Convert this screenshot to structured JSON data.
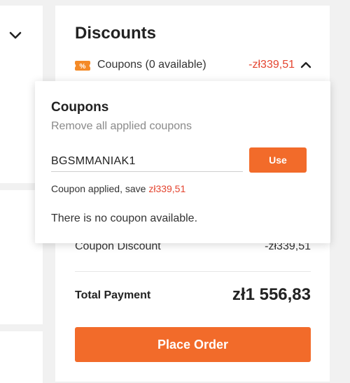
{
  "discounts": {
    "title": "Discounts",
    "coupons_label": "Coupons (0 available)",
    "coupons_amount": "-zł339,51",
    "tag_icon": "coupon-tag-icon",
    "tag_symbol": "%"
  },
  "popup": {
    "title": "Coupons",
    "remove_all": "Remove all applied coupons",
    "code_value": "BGSMMANIAK1",
    "use_label": "Use",
    "applied_prefix": "Coupon applied, save ",
    "applied_amount": "zł339,51",
    "no_coupon": "There is no coupon available."
  },
  "summary": {
    "coupon_discount_label": "Coupon Discount",
    "coupon_discount_value": "-zł339,51",
    "total_label": "Total Payment",
    "total_value": "zł1 556,83",
    "place_order_label": "Place Order"
  },
  "colors": {
    "accent": "#f26b2a",
    "discount_red": "#e4442f"
  }
}
